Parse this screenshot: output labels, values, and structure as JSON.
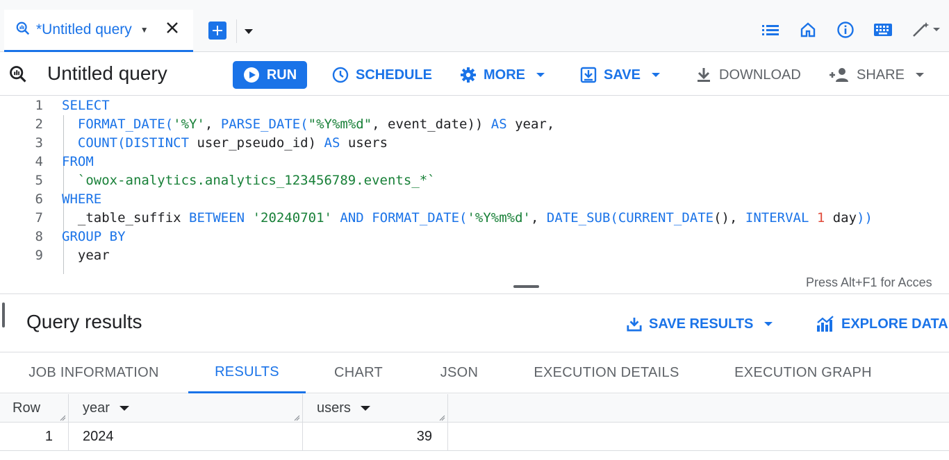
{
  "tab": {
    "label": "*Untitled query"
  },
  "toolbar": {
    "title": "Untitled query",
    "run": "RUN",
    "schedule": "SCHEDULE",
    "more": "MORE",
    "save": "SAVE",
    "download": "DOWNLOAD",
    "share": "SHARE"
  },
  "editor": {
    "lines": [
      {
        "n": "1",
        "tokens": [
          {
            "t": "SELECT",
            "c": "kw"
          }
        ]
      },
      {
        "n": "2",
        "tokens": [
          {
            "t": "  FORMAT_DATE(",
            "c": "kw"
          },
          {
            "t": "'%Y'",
            "c": "str"
          },
          {
            "t": ", ",
            "c": "id"
          },
          {
            "t": "PARSE_DATE(",
            "c": "kw"
          },
          {
            "t": "\"%Y%m%d\"",
            "c": "str"
          },
          {
            "t": ", event_date)) ",
            "c": "id"
          },
          {
            "t": "AS",
            "c": "kw"
          },
          {
            "t": " year,",
            "c": "id"
          }
        ]
      },
      {
        "n": "3",
        "tokens": [
          {
            "t": "  COUNT(DISTINCT",
            "c": "kw"
          },
          {
            "t": " user_pseudo_id) ",
            "c": "id"
          },
          {
            "t": "AS",
            "c": "kw"
          },
          {
            "t": " users",
            "c": "id"
          }
        ]
      },
      {
        "n": "4",
        "tokens": [
          {
            "t": "FROM",
            "c": "kw"
          }
        ]
      },
      {
        "n": "5",
        "tokens": [
          {
            "t": "  `owox-analytics.analytics_123456789.events_*`",
            "c": "str"
          }
        ]
      },
      {
        "n": "6",
        "tokens": [
          {
            "t": "WHERE",
            "c": "kw"
          }
        ]
      },
      {
        "n": "7",
        "tokens": [
          {
            "t": "  _table_suffix ",
            "c": "id"
          },
          {
            "t": "BETWEEN",
            "c": "kw"
          },
          {
            "t": " ",
            "c": "id"
          },
          {
            "t": "'20240701'",
            "c": "str"
          },
          {
            "t": " ",
            "c": "id"
          },
          {
            "t": "AND",
            "c": "kw"
          },
          {
            "t": " ",
            "c": "id"
          },
          {
            "t": "FORMAT_DATE(",
            "c": "kw"
          },
          {
            "t": "'%Y%m%d'",
            "c": "str"
          },
          {
            "t": ", ",
            "c": "id"
          },
          {
            "t": "DATE_SUB(",
            "c": "kw"
          },
          {
            "t": "CURRENT_DATE",
            "c": "kw"
          },
          {
            "t": "(), ",
            "c": "id"
          },
          {
            "t": "INTERVAL",
            "c": "kw"
          },
          {
            "t": " ",
            "c": "id"
          },
          {
            "t": "1",
            "c": "num"
          },
          {
            "t": " day",
            "c": "id"
          },
          {
            "t": "))",
            "c": "kw"
          }
        ]
      },
      {
        "n": "8",
        "tokens": [
          {
            "t": "GROUP BY",
            "c": "kw"
          }
        ]
      },
      {
        "n": "9",
        "tokens": [
          {
            "t": "  year",
            "c": "id"
          }
        ]
      }
    ],
    "access_hint": "Press Alt+F1 for Acces"
  },
  "results": {
    "title": "Query results",
    "save_results": "SAVE RESULTS",
    "explore_data": "EXPLORE DATA",
    "tabs": [
      "JOB INFORMATION",
      "RESULTS",
      "CHART",
      "JSON",
      "EXECUTION DETAILS",
      "EXECUTION GRAPH"
    ],
    "active_tab": "RESULTS",
    "columns": [
      "Row",
      "year",
      "users"
    ],
    "rows": [
      {
        "row": "1",
        "year": "2024",
        "users": "39"
      }
    ]
  },
  "colors": {
    "accent": "#1a73e8",
    "keyword": "#1a73e8",
    "string": "#188038",
    "number": "#e04b3a"
  }
}
